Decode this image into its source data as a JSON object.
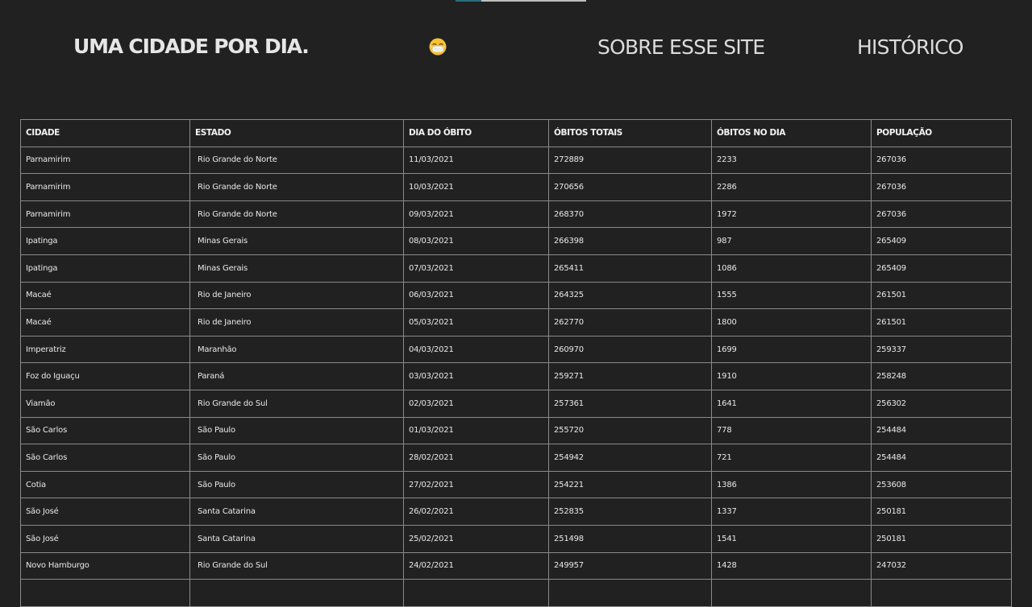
{
  "header": {
    "brand": "UMA CIDADE POR DIA.",
    "emoji_icon": "face-with-medical-mask-icon",
    "nav": [
      {
        "label": "SOBRE ESSE SITE"
      },
      {
        "label": "HISTÓRICO"
      }
    ]
  },
  "colors": {
    "background": "#212121",
    "text": "#ececec",
    "border": "#8a8a8a",
    "accent": "#2b6f7a"
  },
  "table": {
    "columns": [
      "CIDADE",
      "ESTADO",
      "DIA DO ÓBITO",
      "ÓBITOS TOTAIS",
      "ÓBITOS NO DIA",
      "POPULAÇÃO"
    ],
    "rows": [
      [
        "Parnamirim",
        "Rio Grande do Norte",
        "11/03/2021",
        "272889",
        "2233",
        "267036"
      ],
      [
        "Parnamirim",
        "Rio Grande do Norte",
        "10/03/2021",
        "270656",
        "2286",
        "267036"
      ],
      [
        "Parnamirim",
        "Rio Grande do Norte",
        "09/03/2021",
        "268370",
        "1972",
        "267036"
      ],
      [
        "Ipatinga",
        "Minas Gerais",
        "08/03/2021",
        "266398",
        "987",
        "265409"
      ],
      [
        "Ipatinga",
        "Minas Gerais",
        "07/03/2021",
        "265411",
        "1086",
        "265409"
      ],
      [
        "Macaé",
        "Rio de Janeiro",
        "06/03/2021",
        "264325",
        "1555",
        "261501"
      ],
      [
        "Macaé",
        "Rio de Janeiro",
        "05/03/2021",
        "262770",
        "1800",
        "261501"
      ],
      [
        "Imperatriz",
        "Maranhão",
        "04/03/2021",
        "260970",
        "1699",
        "259337"
      ],
      [
        "Foz do Iguaçu",
        "Paraná",
        "03/03/2021",
        "259271",
        "1910",
        "258248"
      ],
      [
        "Viamão",
        "Rio Grande do Sul",
        "02/03/2021",
        "257361",
        "1641",
        "256302"
      ],
      [
        "São Carlos",
        "São Paulo",
        "01/03/2021",
        "255720",
        "778",
        "254484"
      ],
      [
        "São Carlos",
        "São Paulo",
        "28/02/2021",
        "254942",
        "721",
        "254484"
      ],
      [
        "Cotia",
        "São Paulo",
        "27/02/2021",
        "254221",
        "1386",
        "253608"
      ],
      [
        "São José",
        "Santa Catarina",
        "26/02/2021",
        "252835",
        "1337",
        "250181"
      ],
      [
        "São José",
        "Santa Catarina",
        "25/02/2021",
        "251498",
        "1541",
        "250181"
      ],
      [
        "Novo Hamburgo",
        "Rio Grande do Sul",
        "24/02/2021",
        "249957",
        "1428",
        "247032"
      ],
      [
        "",
        "",
        "",
        "",
        "",
        ""
      ]
    ]
  }
}
